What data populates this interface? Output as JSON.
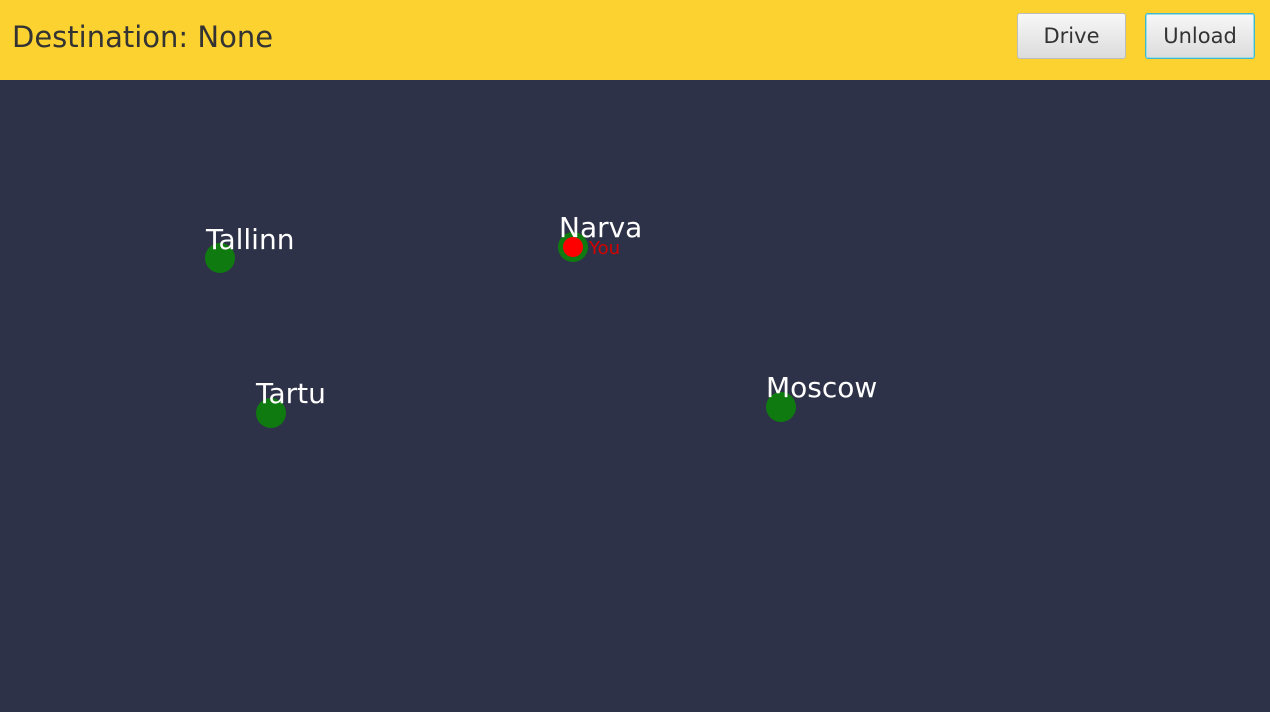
{
  "header": {
    "destination_text": "Destination: None",
    "drive_label": "Drive",
    "unload_label": "Unload"
  },
  "map": {
    "cities": [
      {
        "name": "Tallinn"
      },
      {
        "name": "Narva"
      },
      {
        "name": "Tartu"
      },
      {
        "name": "Moscow"
      }
    ],
    "player": {
      "label": "You",
      "current_city": "Narva"
    }
  },
  "colors": {
    "header_bg": "#fbd22f",
    "map_bg": "#2e3248",
    "city_dot": "#0f7a0f",
    "player_dot": "#ff0000",
    "focus_border": "#3fb8cf"
  }
}
